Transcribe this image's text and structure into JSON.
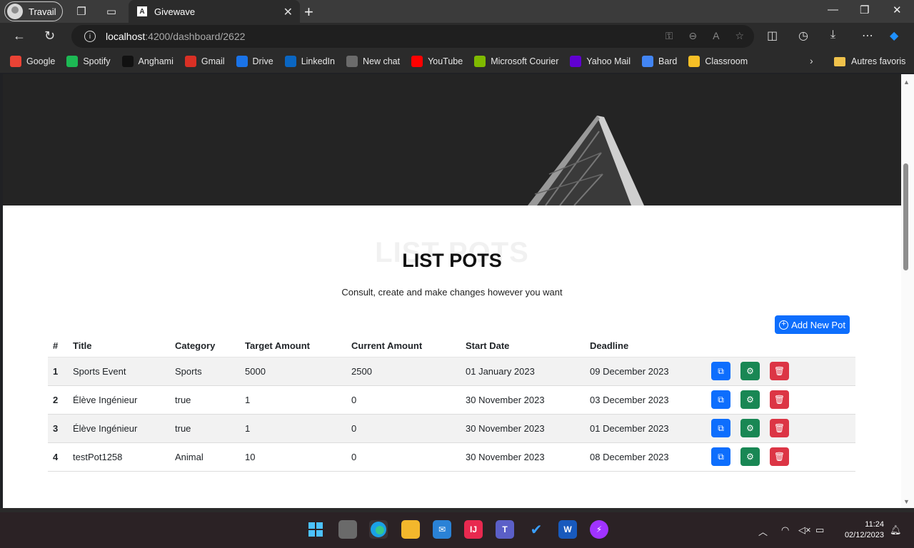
{
  "browser": {
    "profile_label": "Travail",
    "tab_title": "Givewave",
    "url_host": "localhost",
    "url_path": ":4200/dashboard/2622"
  },
  "bookmarks": [
    {
      "label": "Google",
      "icon": "google-icon",
      "color": "#ea4335"
    },
    {
      "label": "Spotify",
      "icon": "spotify-icon",
      "color": "#1db954"
    },
    {
      "label": "Anghami",
      "icon": "anghami-icon",
      "color": "#111111"
    },
    {
      "label": "Gmail",
      "icon": "gmail-icon",
      "color": "#d93025"
    },
    {
      "label": "Drive",
      "icon": "drive-icon",
      "color": "#1a73e8"
    },
    {
      "label": "LinkedIn",
      "icon": "linkedin-icon",
      "color": "#0a66c2"
    },
    {
      "label": "New chat",
      "icon": "chatgpt-icon",
      "color": "#6b6b6b"
    },
    {
      "label": "YouTube",
      "icon": "youtube-icon",
      "color": "#ff0000"
    },
    {
      "label": "Microsoft Courier",
      "icon": "microsoft-icon",
      "color": "#7fba00"
    },
    {
      "label": "Yahoo Mail",
      "icon": "yahoo-icon",
      "color": "#6001d2"
    },
    {
      "label": "Bard",
      "icon": "bard-icon",
      "color": "#4285f4"
    },
    {
      "label": "Classroom",
      "icon": "classroom-icon",
      "color": "#f6bf26"
    }
  ],
  "other_bookmarks_label": "Autres favoris",
  "page": {
    "section_bg_text": "LIST POTS",
    "section_title": "LIST POTS",
    "section_subtitle": "Consult, create and make changes however you want",
    "add_button_label": "Add New Pot"
  },
  "table": {
    "headers": [
      "#",
      "Title",
      "Category",
      "Target Amount",
      "Current Amount",
      "Start Date",
      "Deadline"
    ],
    "rows": [
      {
        "num": "1",
        "title": "Sports Event",
        "category": "Sports",
        "target": "5000",
        "current": "2500",
        "start": "01 January 2023",
        "deadline": "09 December 2023"
      },
      {
        "num": "2",
        "title": "Élève Ingénieur",
        "category": "true",
        "target": "1",
        "current": "0",
        "start": "30 November 2023",
        "deadline": "03 December 2023"
      },
      {
        "num": "3",
        "title": "Élève Ingénieur",
        "category": "true",
        "target": "1",
        "current": "0",
        "start": "30 November 2023",
        "deadline": "01 December 2023"
      },
      {
        "num": "4",
        "title": "testPot1258",
        "category": "Animal",
        "target": "10",
        "current": "0",
        "start": "30 November 2023",
        "deadline": "08 December 2023"
      }
    ]
  },
  "taskbar": {
    "time": "11:24",
    "date": "02/12/2023"
  },
  "colors": {
    "primary": "#0d6efd",
    "success": "#198754",
    "danger": "#dc3545"
  }
}
